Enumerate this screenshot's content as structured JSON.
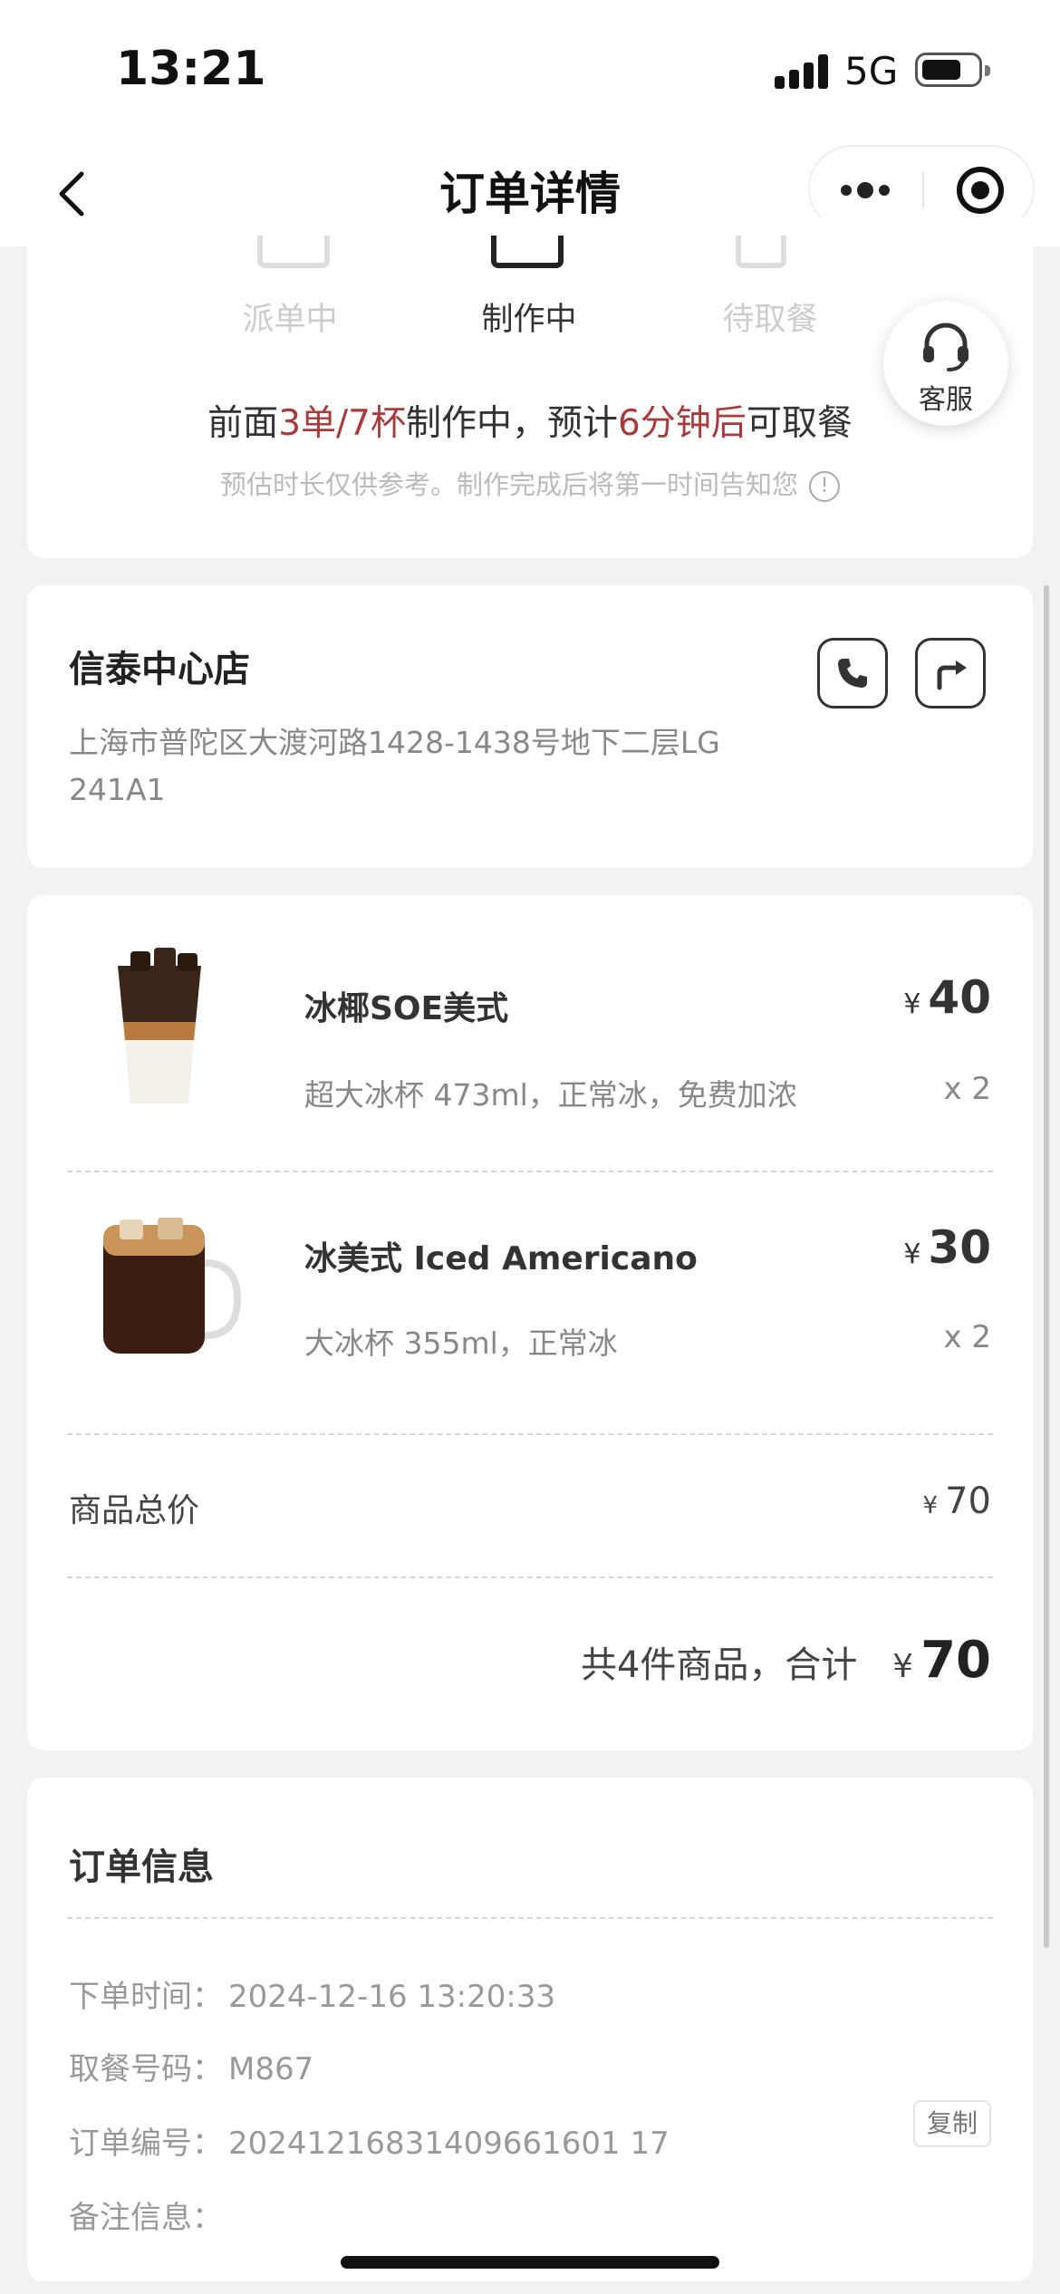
{
  "status_bar": {
    "time": "13:21",
    "network": "5G"
  },
  "nav": {
    "title": "订单详情"
  },
  "progress": {
    "steps": [
      {
        "label": "派单中",
        "active": false
      },
      {
        "label": "制作中",
        "active": true
      },
      {
        "label": "待取餐",
        "active": false
      }
    ],
    "service_label": "客服",
    "msg": {
      "p1": "前面",
      "queue": "3单/7杯",
      "p2": "制作中，预计",
      "eta": "6分钟后",
      "p3": "可取餐"
    },
    "note": "预估时长仅供参考。制作完成后将第一时间告知您",
    "info_icon": "!"
  },
  "store": {
    "name": "信泰中心店",
    "address": "上海市普陀区大渡河路1428-1438号地下二层LG 241A1",
    "phone_icon": "phone-icon",
    "nav_icon": "navigation-icon"
  },
  "items": [
    {
      "name": "冰椰SOE美式",
      "currency": "¥",
      "price": "40",
      "spec": "超大冰杯 473ml，正常冰，免费加浓",
      "qty": "x 2"
    },
    {
      "name": "冰美式 Iced Americano",
      "currency": "¥",
      "price": "30",
      "spec": "大冰杯 355ml，正常冰",
      "qty": "x 2"
    }
  ],
  "summary": {
    "subtotal_label": "商品总价",
    "subtotal_currency": "¥",
    "subtotal_value": "70",
    "total_prefix": "共4件商品，合计",
    "total_currency": "¥",
    "total_value": "70"
  },
  "order_info": {
    "title": "订单信息",
    "rows": [
      {
        "label": "下单时间：",
        "value": "2024-12-16 13:20:33"
      },
      {
        "label": "取餐号码：",
        "value": "M867"
      },
      {
        "label": "订单编号：",
        "value": "20241216831409661601 17"
      },
      {
        "label": "备注信息：",
        "value": ""
      }
    ],
    "copy_label": "复制"
  },
  "colors": {
    "highlight": "#a63b3b",
    "background": "#f2f2f2"
  }
}
